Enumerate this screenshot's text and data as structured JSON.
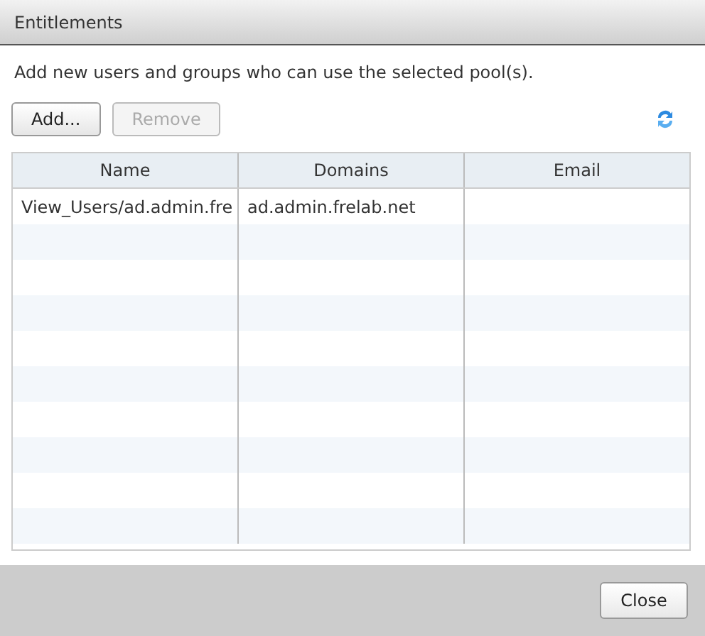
{
  "window": {
    "title": "Entitlements"
  },
  "description": "Add new users and groups who can use the selected pool(s).",
  "toolbar": {
    "buttons": [
      {
        "label": "Add...",
        "disabled": false
      },
      {
        "label": "Remove",
        "disabled": true
      }
    ]
  },
  "table": {
    "columns": [
      "Name",
      "Domains",
      "Email"
    ],
    "rows": [
      {
        "cells": [
          "View_Users/ad.admin.fre",
          "ad.admin.frelab.net",
          null
        ]
      }
    ]
  },
  "footer": {
    "buttons": [
      "Close"
    ]
  }
}
